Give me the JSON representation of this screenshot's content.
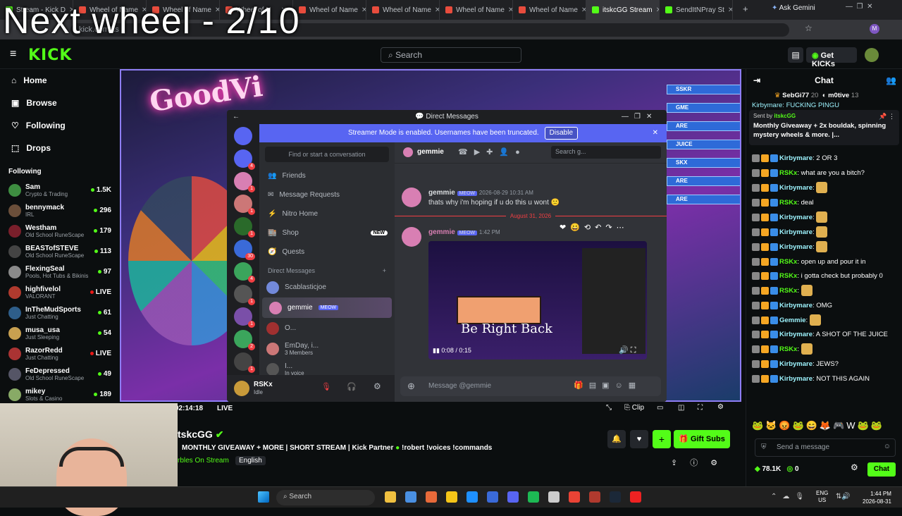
{
  "overlay_title": "Next wheel - 2/10",
  "browser": {
    "tabs": [
      {
        "label": "Stream - Kick D",
        "color": "#53fc18"
      },
      {
        "label": "Wheel of Name",
        "color": "#e84c3d"
      },
      {
        "label": "Wheel of Name",
        "color": "#e84c3d"
      },
      {
        "label": "Wheel of N",
        "color": "#e84c3d"
      },
      {
        "label": "Wheel of Name",
        "color": "#e84c3d"
      },
      {
        "label": "Wheel of Name",
        "color": "#e84c3d"
      },
      {
        "label": "Wheel of Name",
        "color": "#e84c3d"
      },
      {
        "label": "Wheel of Name",
        "color": "#e84c3d"
      },
      {
        "label": "itskcGG Stream",
        "color": "#53fc18"
      },
      {
        "label": "SendItNPray St",
        "color": "#53fc18"
      }
    ],
    "ask_gemini": "Ask Gemini",
    "address": "kick.com/its"
  },
  "kick": {
    "logo": "KICK",
    "search_placeholder": "Search",
    "get_kicks": "Get KICKs"
  },
  "sidebar": {
    "nav": [
      {
        "label": "Home",
        "icon": "home-icon"
      },
      {
        "label": "Browse",
        "icon": "browse-icon"
      },
      {
        "label": "Following",
        "icon": "heart-icon"
      },
      {
        "label": "Drops",
        "icon": "drops-icon"
      }
    ],
    "following_header": "Following",
    "channels": [
      {
        "name": "Sam",
        "sub": "Crypto & Trading",
        "count": "1.5K",
        "color": "#3e8e41"
      },
      {
        "name": "bennymack",
        "sub": "IRL",
        "count": "296",
        "color": "#6b4f3a"
      },
      {
        "name": "Westham",
        "sub": "Old School RuneScape",
        "count": "179",
        "color": "#7a1f2b"
      },
      {
        "name": "BEASTofSTEVE",
        "sub": "Old School RuneScape",
        "count": "113",
        "color": "#444"
      },
      {
        "name": "FlexingSeal",
        "sub": "Pools, Hot Tubs & Bikinis",
        "count": "97",
        "color": "#8a8a8a"
      },
      {
        "name": "highfivelol",
        "sub": "VALORANT",
        "count": "LIVE",
        "color": "#b03a2e"
      },
      {
        "name": "InTheMudSports",
        "sub": "Just Chatting",
        "count": "61",
        "color": "#2e5e8a"
      },
      {
        "name": "musa_usa",
        "sub": "Just Sleeping",
        "count": "54",
        "color": "#c8a050"
      },
      {
        "name": "RazorRedd",
        "sub": "Just Chatting",
        "count": "LIVE",
        "color": "#a33"
      },
      {
        "name": "FeDepressed",
        "sub": "Old School RuneScape",
        "count": "49",
        "color": "#556"
      },
      {
        "name": "mikey",
        "sub": "Slots & Casino",
        "count": "189",
        "color": "#8a6"
      }
    ]
  },
  "video": {
    "neon_text": "GoodVi",
    "time": "02:14:18",
    "live": "LIVE",
    "clip": "Clip",
    "panel_labels": [
      "SSKR",
      "GME",
      "ARE",
      "JUICE",
      "SKX",
      "ARE",
      "ARE"
    ]
  },
  "discord": {
    "window_title": "Direct Messages",
    "banner": "Streamer Mode is enabled. Usernames have been truncated.",
    "banner_button": "Disable",
    "find_placeholder": "Find or start a conversation",
    "header_user": "gemmie",
    "header_search": "Search g...",
    "channels": [
      "Friends",
      "Message Requests",
      "Nitro Home",
      "Shop",
      "Quests"
    ],
    "shop_badge": "NEW",
    "dm_header": "Direct Messages",
    "dms": [
      {
        "name": "Scablasticjoe",
        "sub": "",
        "color": "#7289da"
      },
      {
        "name": "gemmie",
        "sub": "",
        "color": "#d87fb3",
        "tag": "MEOW"
      },
      {
        "name": "O...",
        "sub": "",
        "color": "#a03030"
      },
      {
        "name": "EmDay, i...",
        "sub": "3 Members",
        "color": "#c77"
      },
      {
        "name": "I...",
        "sub": "In voice",
        "color": "#555"
      }
    ],
    "user": {
      "name": "RSKx",
      "status": "Idle"
    },
    "messages": [
      {
        "author": "gemmie",
        "tag": "MEOW",
        "time": "2026-08-29 10:31 AM",
        "text": "thats why i'm hoping if u do this u wont 🙁"
      },
      {
        "author": "gemmie",
        "tag": "MEOW",
        "time": "1:42 PM",
        "text": ""
      }
    ],
    "date_divider": "August 31, 2026",
    "video_caption": "Be Right Back",
    "video_time": "0:08 / 0:15",
    "message_placeholder": "Message @gemmie",
    "server_badges": [
      "4",
      "1",
      "1",
      "1",
      "30",
      "4",
      "1",
      "1",
      "2",
      "1",
      "1"
    ],
    "new_badge": "NEW"
  },
  "chat": {
    "title": "Chat",
    "top_gifters": [
      {
        "name": "SebGi77",
        "count": "20"
      },
      {
        "name": "m0tive",
        "count": "13"
      }
    ],
    "pinned_by": "Sent by",
    "pinned_user": "itskcGG",
    "pinned_text": "Monthly Giveaway + 2x bouldak, spinning mystery wheels & more. |...",
    "top_line": "Kirbymare: FUCKING PINGU",
    "lines": [
      {
        "user": "Kirbymare",
        "text": "2 OR 3",
        "color": "#9ef4ff"
      },
      {
        "user": "RSKx",
        "text": "what are you a bitch?",
        "color": "#53fc18"
      },
      {
        "user": "Kirbymare",
        "text": "",
        "color": "#9ef4ff",
        "emote": true
      },
      {
        "user": "RSKx",
        "text": "deal",
        "color": "#53fc18"
      },
      {
        "user": "Kirbymare",
        "text": "",
        "color": "#9ef4ff",
        "emote": true
      },
      {
        "user": "Kirbymare",
        "text": "",
        "color": "#9ef4ff",
        "emote": true
      },
      {
        "user": "Kirbymare",
        "text": "",
        "color": "#9ef4ff",
        "emote": true
      },
      {
        "user": "RSKx",
        "text": "open up and pour it in",
        "color": "#53fc18"
      },
      {
        "user": "RSKx",
        "text": "i gotta check but probably 0",
        "color": "#53fc18",
        "wrap": true
      },
      {
        "user": "RSKx",
        "text": "",
        "color": "#53fc18",
        "emote": true
      },
      {
        "user": "Kirbymare",
        "text": "OMG",
        "color": "#9ef4ff"
      },
      {
        "user": "Gemmie",
        "text": "",
        "color": "#9ef4ff",
        "emote": true
      },
      {
        "user": "Kirbymare",
        "text": "A SHOT OF THE JUICE",
        "color": "#9ef4ff",
        "wrap": true
      },
      {
        "user": "RSKx",
        "text": "",
        "color": "#53fc18",
        "emote": true
      },
      {
        "user": "Kirbymare",
        "text": "JEWS?",
        "color": "#9ef4ff"
      },
      {
        "user": "Kirbymare",
        "text": "NOT THIS AGAIN",
        "color": "#9ef4ff"
      }
    ],
    "send_placeholder": "Send a message",
    "kicks_count": "78.1K",
    "points": "0",
    "chat_button": "Chat"
  },
  "stream": {
    "streamer": "tskcGG",
    "title": "MONTHLY GIVEAWAY + MORE | SHORT STREAM | Kick Partner",
    "commands": "!robert !voices !commands",
    "category": "rbles On Stream",
    "language": "English",
    "gift_subs": "Gift Subs"
  },
  "taskbar": {
    "search": "Search",
    "lang_top": "ENG",
    "lang_bottom": "US",
    "clock_time": "1:44 PM",
    "clock_date": "2026-08-31"
  }
}
